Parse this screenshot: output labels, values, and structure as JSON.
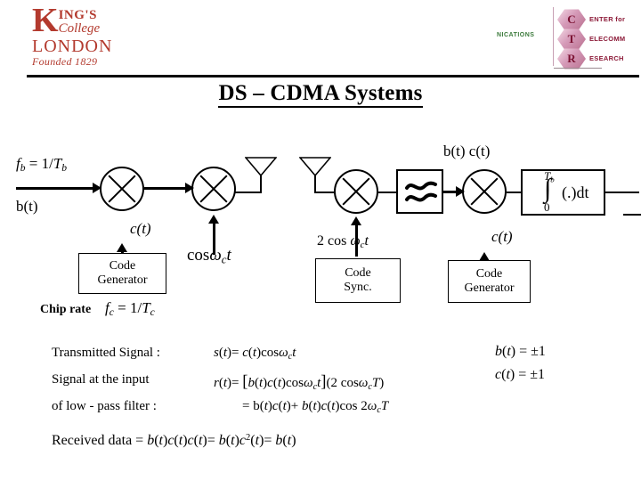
{
  "slide": {
    "title": "DS – CDMA Systems"
  },
  "logos": {
    "kcl": {
      "k": "K",
      "ings": "ING'S",
      "college": "College",
      "london": "LONDON",
      "founded": "Founded 1829",
      "color": "#b33a2e"
    },
    "ctr": {
      "communications_text": "NICATIONS",
      "hexes": [
        {
          "letter": "C",
          "label": "ENTER for"
        },
        {
          "letter": "T",
          "label": "ELECOMM"
        },
        {
          "letter": "R",
          "label": "ESEARCH"
        }
      ],
      "hex_color": "#b9708f",
      "label_color": "#8c1a38",
      "comm_color": "#3b7a3b"
    }
  },
  "diagram": {
    "input_rate_label": "f",
    "input_rate_sub": "b",
    "input_rate_rest": " = 1 / T",
    "input_rate_sub2": "b",
    "input_signal": "b(t)",
    "code_signal_tx": "c(t)",
    "carrier_tx": "cos",
    "carrier_tx_omega": "ω",
    "carrier_tx_sub": "c",
    "carrier_tx_t": "t",
    "code_generator_tx": {
      "line1": "Code",
      "line2": "Generator"
    },
    "chip_rate_label": "Chip rate",
    "chip_rate_eq_f": "f",
    "chip_rate_eq_sub": "c",
    "chip_rate_eq_rest": " = 1 / T",
    "chip_rate_eq_sub2": "c",
    "carrier_rx": "2 cos",
    "carrier_rx_omega": "ω",
    "carrier_rx_sub": "c",
    "carrier_rx_t": "t",
    "code_sync": {
      "line1": "Code",
      "line2": "Sync."
    },
    "lpf_symbol": "low-pass-filter",
    "despread_label": "b(t) c(t)",
    "code_signal_rx": "c(t)",
    "code_generator_rx": {
      "line1": "Code",
      "line2": "Generator"
    },
    "integrator": {
      "upper_limit": "T",
      "upper_limit_sub": "b",
      "integrand": "(.)dt",
      "lower_limit": "0"
    }
  },
  "equations": {
    "left_labels": [
      "Transmitted Signal :",
      "Signal at the input",
      "of low - pass filter :"
    ],
    "line1": {
      "lhs": "s(t) = ",
      "rhs_a": "c(t) cos",
      "rhs_omega": "ω",
      "rhs_sub": "c",
      "rhs_t": "t"
    },
    "line2": {
      "lhs": "r(t) = ",
      "rhs": "[b(t) c(t) cos ω_c t ] (2 cos ω_c T )"
    },
    "line3": {
      "rhs": "= b(t) c(t) + b(t) c(t) cos 2ω_c T"
    },
    "received_data": "Received data = b(t) c(t) c(t) = b(t) c²(t) = b(t)",
    "right": [
      "b(t) = ±1",
      "c(t) = ±1"
    ]
  }
}
